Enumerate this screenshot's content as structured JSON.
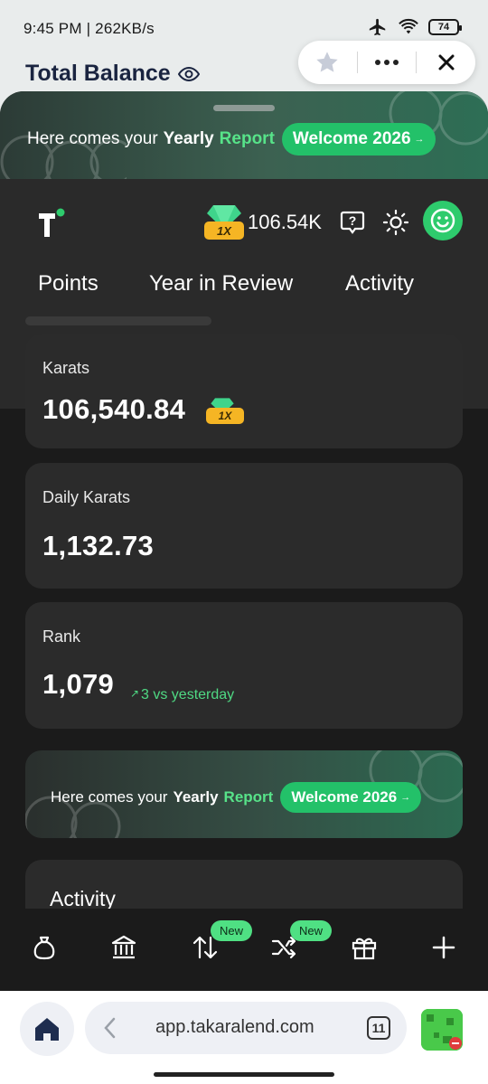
{
  "status_bar": {
    "time_speed": "9:45 PM | 262KB/s",
    "battery": "74",
    "icons": [
      "airplane-icon",
      "wifi-icon",
      "battery-icon"
    ]
  },
  "background_page": {
    "title": "Total Balance"
  },
  "promo": {
    "prefix": "Here comes your",
    "yearly": "Yearly",
    "report": "Report",
    "button": "Welcome 2026",
    "arrow": "→"
  },
  "header": {
    "multiplier": "1X",
    "balance": "106.54K"
  },
  "tabs": [
    {
      "label": "Points"
    },
    {
      "label": "Year in Review"
    },
    {
      "label": "Activity"
    }
  ],
  "cards": {
    "karats": {
      "label": "Karats",
      "value": "106,540.84",
      "multiplier": "1X"
    },
    "daily": {
      "label": "Daily Karats",
      "value": "1,132.73"
    },
    "rank": {
      "label": "Rank",
      "value": "1,079",
      "delta_arrow": "↗",
      "delta": "3 vs yesterday"
    }
  },
  "activity": {
    "title": "Activity"
  },
  "bottom_nav": {
    "badge_swap": "New",
    "badge_bridge": "New"
  },
  "browser": {
    "url": "app.takaralend.com",
    "tab_count": "11"
  },
  "colors": {
    "accent_green": "#23c169",
    "badge_gold": "#f5b524",
    "sheet_bg": "#1b1b1b",
    "card_bg": "#2b2b2b"
  }
}
